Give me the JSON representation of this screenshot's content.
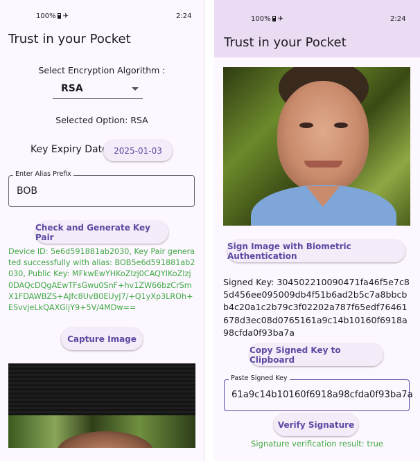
{
  "left": {
    "status": {
      "battery": "100%",
      "time": "2:24"
    },
    "title": "Trust in your Pocket",
    "algo_label": "Select Encryption Algorithm :",
    "algo_value": "RSA",
    "selected_option": "Selected Option: RSA",
    "expiry_label": "Key Expiry Date:",
    "expiry_value": "2025-01-03",
    "alias_label": "Enter Alias Prefix",
    "alias_value": "BOB",
    "generate_button": "Check and Generate Key Pair",
    "device_info": "Device ID: 5e6d591881ab2030, Key Pair generated successfully with alias: BOB5e6d591881ab2030, Public Key: MFkwEwYHKoZIzj0CAQYIKoZIzj0DAQcDQgAEwTFsGwu0SnF+hv1ZW66bzCrSmX1FDAWBZS+AJfc8UvB0EUyJ7/+Q1yXp3LROh+ESvvjeLkQAXGijY9+5V/4MDw==",
    "capture_button": "Capture Image"
  },
  "right": {
    "status": {
      "battery": "100%",
      "time": "2:24"
    },
    "title": "Trust in your Pocket",
    "sign_button": "Sign Image with Biometric Authentication",
    "signed_key_text": "Signed Key: 304502210090471fa46f5e7c85d456ee095009db4f51b6ad2b5c7a8bbcbb4c20a1c2b79c3f02202a787f65edf76461678d3ec08d0765161a9c14b10160f6918a98cfda0f93ba7a",
    "copy_button": "Copy Signed Key to Clipboard",
    "paste_label": "Paste Signed Key",
    "paste_value": "61a9c14b10160f6918a98cfda0f93ba7a",
    "verify_button": "Verify Signature",
    "verify_result": "Signature verification result: true"
  },
  "colors": {
    "accent": "#5a4aa3",
    "success": "#3fa944",
    "appbar": "#eadcf3",
    "background": "#fdf7ff"
  }
}
